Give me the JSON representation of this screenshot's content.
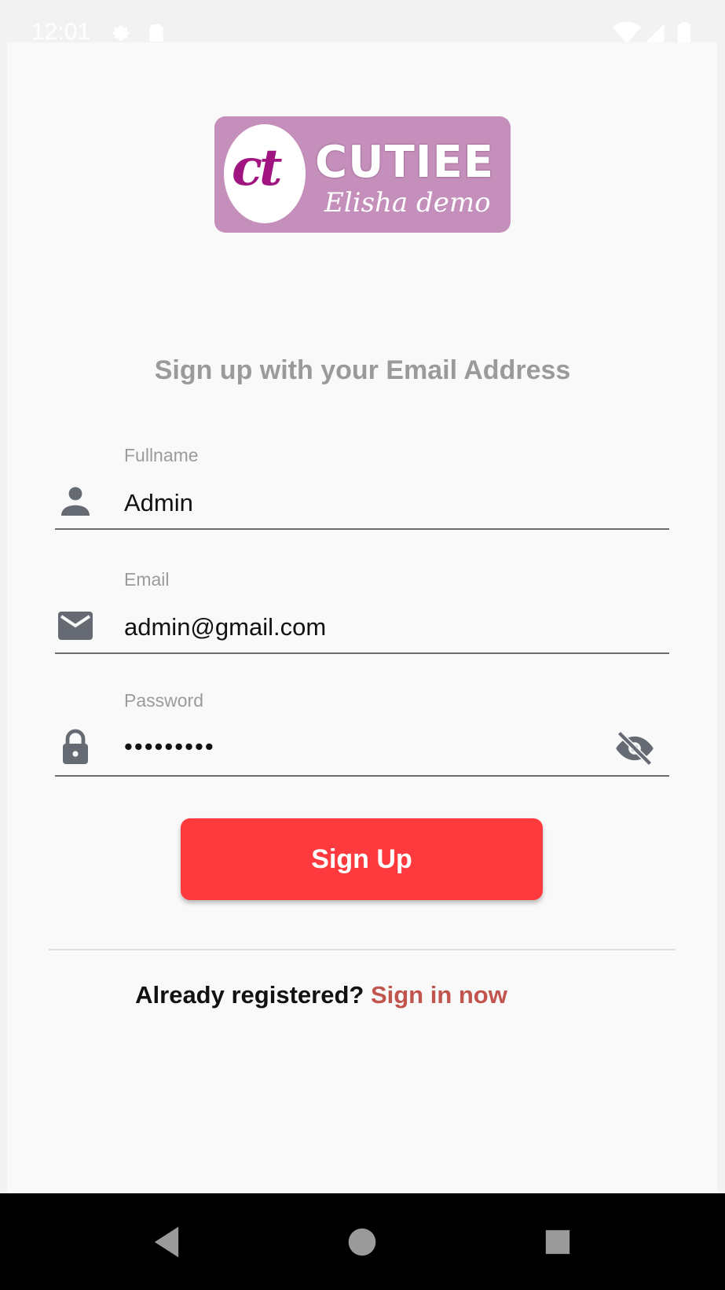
{
  "status_bar": {
    "time": "12:01",
    "icons": [
      "settings-icon",
      "sim-card-icon",
      "wifi-icon",
      "cell-signal-icon",
      "battery-icon"
    ]
  },
  "logo": {
    "mark_text": "ct",
    "brand_text": "CUTIEE",
    "tagline_text": "Elisha demo",
    "colors": {
      "background": "#c58fbb",
      "mark": "#a0157f"
    }
  },
  "heading": "Sign up with your Email Address",
  "form": {
    "fullname": {
      "label": "Fullname",
      "value": "Admin",
      "icon": "person-icon"
    },
    "email": {
      "label": "Email",
      "value": "admin@gmail.com",
      "icon": "mail-icon"
    },
    "password": {
      "label": "Password",
      "value": "•••••••••",
      "icon": "lock-icon",
      "toggle_icon": "eye-off-icon"
    }
  },
  "signup_button": {
    "label": "Sign Up",
    "color": "#ff3a3f"
  },
  "signin": {
    "prompt": "Already registered? ",
    "link": "Sign in now",
    "link_color": "#c2544e"
  },
  "nav": {
    "icons": [
      "back-icon",
      "home-icon",
      "recents-icon"
    ]
  }
}
